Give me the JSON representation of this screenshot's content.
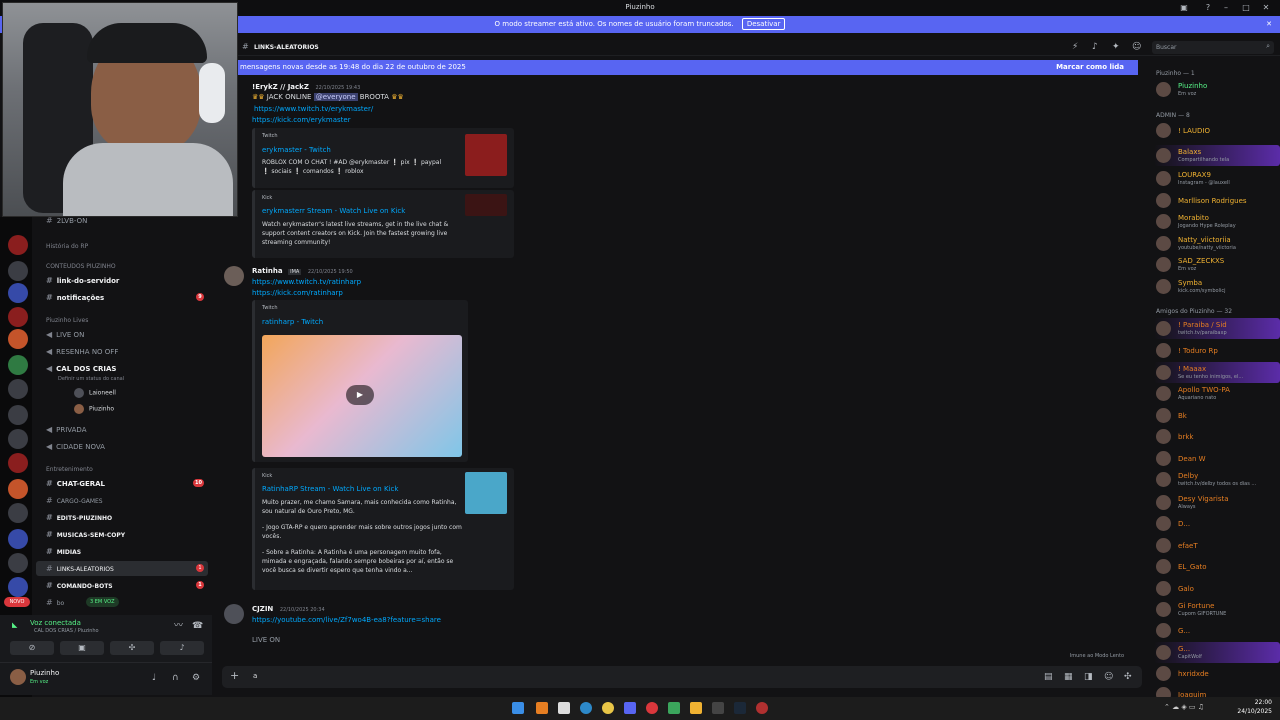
{
  "window": {
    "title": "Piuzinho"
  },
  "banner": {
    "text": "O modo streamer está ativo. Os nomes de usuário foram truncados.",
    "button": "Desativar"
  },
  "header": {
    "channel": "LINKS-ALEATORIOS",
    "search_placeholder": "Buscar"
  },
  "newbar": {
    "text": "mensagens novas desde as 19:48 do dia 22 de outubro de 2025",
    "action": "Marcar como lida"
  },
  "sidebar": {
    "top_item": "2LVB-ON",
    "categories": {
      "rp": "História do RP",
      "conteudos": "CONTEUDOS PIUZINHO",
      "lives": "Piuzinho Lives",
      "entretenimento": "Entretenimento"
    },
    "channels": {
      "link_servidor": "link-do-servidor",
      "notificacoes": "notificações",
      "notificacoes_badge": "9",
      "live_on": "LIVE ON",
      "resenha": "RESENHA NO OFF",
      "cal_dos_crias": "CAL DOS CRIAS",
      "cal_status": "Definir um status do canal",
      "privada": "PRIVADA",
      "cidade_nova": "CIDADE NOVA",
      "chat_geral": "CHAT-GERAL",
      "chat_geral_badge": "10",
      "cargo_games": "CARGO-GAMES",
      "edits": "EDITS-PIUZINHO",
      "musicas": "MUSICAS-SEM-COPY",
      "midias": "MIDIAS",
      "links": "LINKS-ALEATORIOS",
      "links_badge": "1",
      "comando_bots": "COMANDO-BOTS",
      "comando_badge": "1",
      "bots": "bo"
    },
    "voice_users": [
      "Laioneell",
      "Piuzinho"
    ],
    "in_voice_label": "3 EM VOZ",
    "new_label": "NOVO"
  },
  "voice_panel": {
    "status": "Voz conectada",
    "channel": "CAL DOS CRIAS / Piuzinho"
  },
  "user_panel": {
    "name": "Piuzinho",
    "status": "Em voz"
  },
  "messages": [
    {
      "author": "!ErykZ // JackZ",
      "time": "22/10/2025 19:43",
      "line1": "JACK ONLINE",
      "mention": "@everyone",
      "line1b": "BROOTA",
      "links": [
        "https://www.twitch.tv/erykmaster/",
        "https://kick.com/erykmaster"
      ],
      "embeds": [
        {
          "provider": "Twitch",
          "title": "erykmaster - Twitch",
          "desc": "ROBLOX COM O CHAT ! #AD @erykmaster ❕ pix ❕ paypal ❕ sociais ❕ comandos ❕ roblox"
        },
        {
          "provider": "Kick",
          "title": "erykmasterr Stream - Watch Live on Kick",
          "desc": "Watch erykmasterr's latest live streams, get in the live chat & support content creators on Kick. Join the fastest growing live streaming community!"
        }
      ]
    },
    {
      "author": "Ratinha",
      "tag": "IMA",
      "time": "22/10/2025 19:50",
      "links": [
        "https://www.twitch.tv/ratinharp",
        "https://kick.com/ratinharp"
      ],
      "embeds": [
        {
          "provider": "Twitch",
          "title": "ratinharp - Twitch"
        },
        {
          "provider": "Kick",
          "title": "RatinhaRP Stream - Watch Live on Kick",
          "desc1": "Muito prazer, me chamo Samara, mais conhecida como Ratinha, sou natural de Ouro Preto, MG.",
          "desc2": "- Jogo GTA-RP e quero aprender mais sobre outros jogos junto com vocês.",
          "desc3": "- Sobre a Ratinha: A Ratinha é uma personagem muito fofa, mimada e engraçada, falando sempre bobeiras por aí, então se você busca se divertir espero que tenha vindo a..."
        }
      ]
    },
    {
      "author": "CJZIN",
      "time": "22/10/2025 20:34",
      "links": [
        "https://youtube.com/live/Zf7wo4B-ea8?feature=share"
      ],
      "text": "LIVE ON"
    }
  ],
  "slow_mode": "Imune ao Modo Lento",
  "composer": {
    "value": "a"
  },
  "members": {
    "groups": [
      {
        "title": "Piuzinho — 1"
      },
      {
        "title": "ADMIN — 8"
      },
      {
        "title": "Amigos do Piuzinho — 32"
      }
    ],
    "list": [
      {
        "name": "Piuzinho",
        "status": "Em voz",
        "color": "#57f287"
      },
      {
        "name": "! LAUDIO",
        "status": "",
        "color": "#f0b232"
      },
      {
        "name": "Balaxs",
        "status": "Compartilhando tela",
        "color": "#f0b232"
      },
      {
        "name": "LOURAX9",
        "status": "Instagram - @lauxell",
        "color": "#f0b232"
      },
      {
        "name": "Marllison Rodrigues",
        "status": "",
        "color": "#f0b232"
      },
      {
        "name": "Morabito",
        "status": "Jogando Hype Roleplay",
        "color": "#f0b232"
      },
      {
        "name": "Natty_viictoriia",
        "status": "youtube/natty_viictoria",
        "color": "#f0b232"
      },
      {
        "name": "SAD_ZECKXS",
        "status": "Em voz",
        "color": "#f0b232"
      },
      {
        "name": "Symba",
        "status": "kick.com/symbolicj",
        "color": "#f0b232"
      },
      {
        "name": "! Paraiba / Sid",
        "status": "twitch.tv/paraibaxp",
        "color": "#e67e22"
      },
      {
        "name": "! Toduro Rp",
        "status": "",
        "color": "#e67e22"
      },
      {
        "name": "! Maaax",
        "status": "Se eu tenho inimigos, el...",
        "color": "#e67e22"
      },
      {
        "name": "Apollo TWO-PA",
        "status": "Aquariano nato",
        "color": "#e67e22"
      },
      {
        "name": "Bk",
        "status": "",
        "color": "#e67e22"
      },
      {
        "name": "brkk",
        "status": "",
        "color": "#e67e22"
      },
      {
        "name": "Dean W",
        "status": "",
        "color": "#e67e22"
      },
      {
        "name": "Delby",
        "status": "twitch.tv/delby todos os dias ...",
        "color": "#e67e22"
      },
      {
        "name": "Desy Vigarista",
        "status": "Always",
        "color": "#e67e22"
      },
      {
        "name": "D...",
        "status": "",
        "color": "#e67e22"
      },
      {
        "name": "efaeT",
        "status": "",
        "color": "#e67e22"
      },
      {
        "name": "EL_Gato",
        "status": "",
        "color": "#e67e22"
      },
      {
        "name": "Galo",
        "status": "",
        "color": "#e67e22"
      },
      {
        "name": "Gi Fortune",
        "status": "Cupom GIFORTUNE",
        "color": "#e67e22"
      },
      {
        "name": "G...",
        "status": "",
        "color": "#e67e22"
      },
      {
        "name": "G...",
        "status": "CapitWolf",
        "color": "#e67e22"
      },
      {
        "name": "hxridxde",
        "status": "",
        "color": "#e67e22"
      },
      {
        "name": "Joaquim",
        "status": "",
        "color": "#e67e22"
      }
    ]
  },
  "taskbar": {
    "time": "22:00",
    "date": "24/10/2025"
  }
}
